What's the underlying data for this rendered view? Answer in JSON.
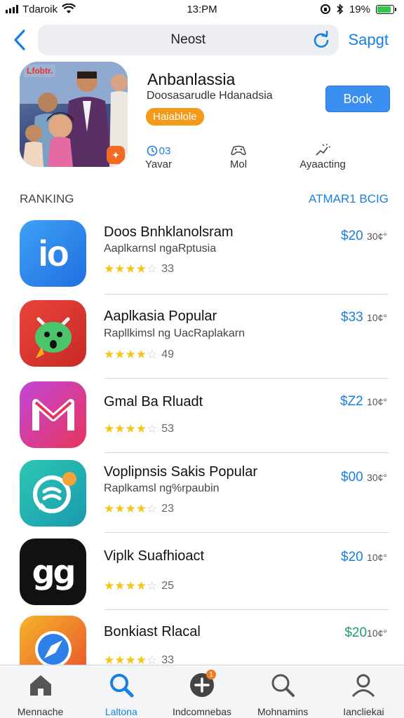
{
  "status_bar": {
    "carrier": "Tdaroik",
    "time": "13:PM",
    "battery": "19%",
    "battery_level": 0.85
  },
  "nav": {
    "title": "Neost",
    "action_label": "Sapgt"
  },
  "featured": {
    "image_tag": "Lfobtr.",
    "title": "Anbanlassia",
    "subtitle": "Doosasarudle Hdanadsia",
    "chip": "Haiablole",
    "button": "Book",
    "stats": [
      {
        "icon": "calendar-icon",
        "value": "03",
        "label": "Yavar"
      },
      {
        "icon": "game-controller-icon",
        "value": "",
        "label": "Mol"
      },
      {
        "icon": "activity-icon",
        "value": "",
        "label": "Ayaacting"
      }
    ]
  },
  "section": {
    "title": "RANKING",
    "link": "ATMAR1 BCIG"
  },
  "apps": [
    {
      "name": "Doos Bnhklanolsram",
      "desc": "Aaplkarnsl ngaRptusia",
      "rating": 4,
      "count": "33",
      "price": "$20",
      "price_sub": "30¢°",
      "price_color": "#1a7fe0",
      "icon_name": "io-app-icon",
      "icon_text": "io"
    },
    {
      "name": "Aaplkasia Popular",
      "desc": "Rapllkimsl ng UacRaplakarn",
      "rating": 4,
      "count": "49",
      "price": "$33",
      "price_sub": "10¢°",
      "price_color": "#1a7fe0",
      "icon_name": "monster-app-icon",
      "icon_text": ""
    },
    {
      "name": "Gmal Ba Rluadt",
      "desc": "",
      "rating": 4,
      "count": "53",
      "price": "$Z2",
      "price_sub": "10¢°",
      "price_color": "#1a7fe0",
      "icon_name": "mail-app-icon",
      "icon_text": "M"
    },
    {
      "name": "Voplipnsis Sakis Popular",
      "desc": "Raplkamsl ng%rpaubin",
      "rating": 4,
      "count": "23",
      "price": "$00",
      "price_sub": "30¢°",
      "price_color": "#1a7fe0",
      "icon_name": "chat-app-icon",
      "icon_text": ""
    },
    {
      "name": "Viplk Suafhioact",
      "desc": "",
      "rating": 4,
      "count": "25",
      "price": "$20",
      "price_sub": "10¢°",
      "price_color": "#1a7fe0",
      "icon_name": "gg-app-icon",
      "icon_text": "gg"
    },
    {
      "name": "Bonkiast Rlacal",
      "desc": "",
      "rating": 4,
      "count": "33",
      "price": "$20",
      "price_sub": "10¢°",
      "price_color": "#1f9e6d",
      "icon_name": "compass-app-icon",
      "icon_text": ""
    }
  ],
  "tabs": [
    {
      "label": "Mennache",
      "icon": "home-icon",
      "active": false
    },
    {
      "label": "Laltona",
      "icon": "search-icon",
      "active": true
    },
    {
      "label": "Indcomnebas",
      "icon": "add-icon",
      "active": false,
      "badge": "1"
    },
    {
      "label": "Mohnamins",
      "icon": "search-icon",
      "active": false
    },
    {
      "label": "Iancliekai",
      "icon": "profile-icon",
      "active": false
    }
  ]
}
